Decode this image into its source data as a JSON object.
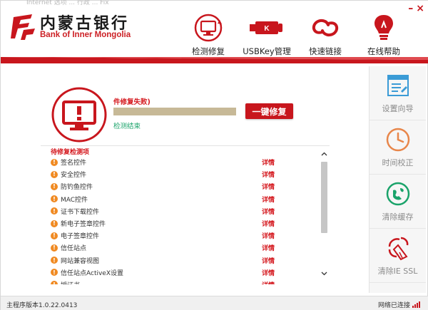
{
  "colors": {
    "brand_red": "#c8161d",
    "warning_orange": "#f08a22",
    "success_green": "#1aa36a",
    "progress_track": "#d9d2c5",
    "progress_fill": "#c7b997"
  },
  "header": {
    "ghost_text": "Internet 选项 ... 行政 ... Fix",
    "logo_cn": "内蒙古银行",
    "logo_en": "Bank of Inner Mongolia",
    "window_controls": {
      "minimize": "–",
      "close": "×"
    },
    "nav": [
      {
        "label": "检测修复",
        "icon": "monitor-repair-icon",
        "active": true
      },
      {
        "label": "USBKey管理",
        "icon": "usb-key-icon",
        "active": false
      },
      {
        "label": "快速链接",
        "icon": "link-icon",
        "active": false
      },
      {
        "label": "在线帮助",
        "icon": "lightbulb-icon",
        "active": false
      }
    ]
  },
  "sidebar": [
    {
      "label": "设置向导",
      "icon": "wizard-icon"
    },
    {
      "label": "时间校正",
      "icon": "clock-icon"
    },
    {
      "label": "清除缓存",
      "icon": "globe-clean-icon"
    },
    {
      "label": "清除IE SSL",
      "icon": "broom-icon"
    }
  ],
  "status": {
    "message": "件修复失败)",
    "progress": 1.0,
    "fix_button": "一键修复",
    "check_done": "检测结束"
  },
  "list": {
    "title": "待修复检测项",
    "detail_label": "详情",
    "items": [
      "签名控件",
      "安全控件",
      "防钓鱼控件",
      "MAC控件",
      "证书下载控件",
      "新电子签章控件",
      "电子签章控件",
      "信任站点",
      "网站兼容视图",
      "信任站点ActiveX设置",
      "授证书"
    ]
  },
  "footer": {
    "version": "主程序版本1.0.22.0413",
    "net_status": "网络已连接"
  }
}
